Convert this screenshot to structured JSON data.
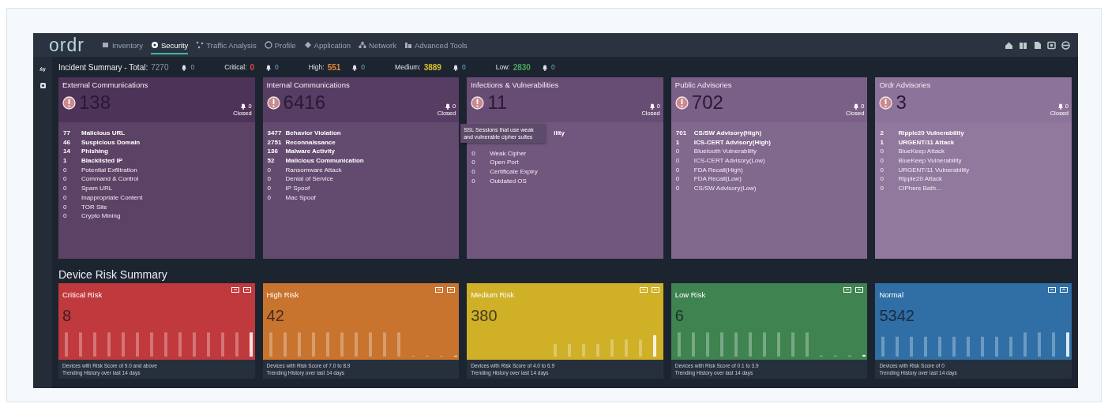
{
  "nav": {
    "logo": "ordr",
    "items": [
      {
        "label": "Inventory",
        "selected": false
      },
      {
        "label": "Security",
        "selected": true
      },
      {
        "label": "Traffic Analysis",
        "selected": false
      },
      {
        "label": "Profile",
        "selected": false
      },
      {
        "label": "Application",
        "selected": false
      },
      {
        "label": "Network",
        "selected": false
      },
      {
        "label": "Advanced Tools",
        "selected": false
      }
    ]
  },
  "incident_summary": {
    "title": "Incident Summary - Total:",
    "total": "7270",
    "closed": "0",
    "levels": [
      {
        "label": "Critical:",
        "value": "0",
        "color": "#e0453f",
        "closed": "0"
      },
      {
        "label": "High:",
        "value": "551",
        "color": "#e08a3a",
        "closed": "0"
      },
      {
        "label": "Medium:",
        "value": "3889",
        "color": "#d9c02e",
        "closed": "0"
      },
      {
        "label": "Low:",
        "value": "2830",
        "color": "#4fa35f",
        "closed": "0"
      }
    ]
  },
  "incident_cards": [
    {
      "title": "External Communications",
      "count": "138",
      "closed": "0",
      "closed_label": "Closed",
      "color": "#4e3358",
      "rows": [
        {
          "kind": "row",
          "count": "77",
          "label": "Malicious URL",
          "active": true
        },
        {
          "kind": "row",
          "count": "46",
          "label": "Suspicious Domain",
          "active": true
        },
        {
          "kind": "row",
          "count": "14",
          "label": "Phishing",
          "active": true
        },
        {
          "kind": "row",
          "count": "1",
          "label": "Blacklisted IP",
          "active": true
        },
        {
          "kind": "row",
          "count": "0",
          "label": "Potential Exfiltration",
          "active": false
        },
        {
          "kind": "row",
          "count": "0",
          "label": "Command & Control",
          "active": false
        },
        {
          "kind": "row",
          "count": "0",
          "label": "Spam URL",
          "active": false
        },
        {
          "kind": "row",
          "count": "0",
          "label": "Inappropriate Content",
          "active": false
        },
        {
          "kind": "row",
          "count": "0",
          "label": "TOR Site",
          "active": false
        },
        {
          "kind": "row",
          "count": "0",
          "label": "Crypto Mining",
          "active": false
        }
      ]
    },
    {
      "title": "Internal Communications",
      "count": "6416",
      "closed": "0",
      "closed_label": "Closed",
      "color": "#573d63",
      "rows": [
        {
          "kind": "row",
          "count": "3477",
          "label": "Behavior Violation",
          "active": true
        },
        {
          "kind": "row",
          "count": "2751",
          "label": "Reconnaissance",
          "active": true
        },
        {
          "kind": "row",
          "count": "136",
          "label": "Malware Activity",
          "active": true
        },
        {
          "kind": "row",
          "count": "52",
          "label": "Malicious Communication",
          "active": true
        },
        {
          "kind": "row",
          "count": "0",
          "label": "Ransomware Attack",
          "active": false
        },
        {
          "kind": "row",
          "count": "0",
          "label": "Denial of Service",
          "active": false
        },
        {
          "kind": "row",
          "count": "0",
          "label": "IP Spoof",
          "active": false
        },
        {
          "kind": "row",
          "count": "0",
          "label": "Mac Spoof",
          "active": false
        }
      ]
    },
    {
      "title": "Infections & Vulnerabilities",
      "count": "11",
      "closed": "0",
      "closed_label": "Closed",
      "color": "#674c74",
      "tooltip": "SSL Sessions that use weak and vulnerable cipher suites",
      "rows": [
        {
          "kind": "partial",
          "label": "ility"
        },
        {
          "kind": "row",
          "count": "0",
          "label": "Weak Cipher",
          "active": false
        },
        {
          "kind": "row",
          "count": "0",
          "label": "Open Port",
          "active": false
        },
        {
          "kind": "row",
          "count": "0",
          "label": "Certificate Expiry",
          "active": false
        },
        {
          "kind": "row",
          "count": "0",
          "label": "Outdated OS",
          "active": false
        }
      ]
    },
    {
      "title": "Public Advisories",
      "count": "702",
      "closed": "0",
      "closed_label": "Closed",
      "color": "#7a5f87",
      "rows": [
        {
          "kind": "row",
          "count": "701",
          "label": "CS/SW Advisory(High)",
          "active": true
        },
        {
          "kind": "row",
          "count": "1",
          "label": "ICS-CERT Advisory(High)",
          "active": true
        },
        {
          "kind": "row",
          "count": "0",
          "label": "Bluetooth Vulnerability",
          "active": false
        },
        {
          "kind": "row",
          "count": "0",
          "label": "ICS-CERT Advisory(Low)",
          "active": false
        },
        {
          "kind": "row",
          "count": "0",
          "label": "FDA Recall(High)",
          "active": false
        },
        {
          "kind": "row",
          "count": "0",
          "label": "FDA Recall(Low)",
          "active": false
        },
        {
          "kind": "row",
          "count": "0",
          "label": "CS/SW Advisory(Low)",
          "active": false
        }
      ]
    },
    {
      "title": "Ordr Advisories",
      "count": "3",
      "closed": "0",
      "closed_label": "Closed",
      "color": "#8c7399",
      "rows": [
        {
          "kind": "row",
          "count": "2",
          "label": "Ripple20 Vulnerability",
          "active": true
        },
        {
          "kind": "row",
          "count": "1",
          "label": "URGENT/11 Attack",
          "active": true
        },
        {
          "kind": "row",
          "count": "0",
          "label": "BlueKeep Attack",
          "active": false
        },
        {
          "kind": "row",
          "count": "0",
          "label": "BlueKeep Vulnerability",
          "active": false
        },
        {
          "kind": "row",
          "count": "0",
          "label": "URGENT/11 Vulnerability",
          "active": false
        },
        {
          "kind": "row",
          "count": "0",
          "label": "Ripple20 Attack",
          "active": false
        },
        {
          "kind": "row",
          "count": "0",
          "label": "CIPhers Bath...",
          "active": false
        }
      ]
    }
  ],
  "device_risk": {
    "title": "Device Risk Summary",
    "cards": [
      {
        "title": "Critical Risk",
        "count": "8",
        "color": "#c0393d",
        "description": "Devices with Risk Score of 9.0 and above",
        "trend": "Trending History over last 14 days"
      },
      {
        "title": "High Risk",
        "count": "42",
        "color": "#c8732e",
        "description": "Devices with Risk Score of 7.0 to 8.9",
        "trend": "Trending History over last 14 days"
      },
      {
        "title": "Medium Risk",
        "count": "380",
        "color": "#cfb026",
        "description": "Devices with Risk Score of 4.0 to 6.9",
        "trend": "Trending History over last 14 days"
      },
      {
        "title": "Low Risk",
        "count": "6",
        "color": "#3f8350",
        "description": "Devices with Risk Score of 0.1 to 3.9",
        "trend": "Trending History over last 14 days"
      },
      {
        "title": "Normal",
        "count": "5342",
        "color": "#2f6fa5",
        "description": "Devices with Risk Score of 0",
        "trend": "Trending History over last 14 days"
      }
    ]
  }
}
